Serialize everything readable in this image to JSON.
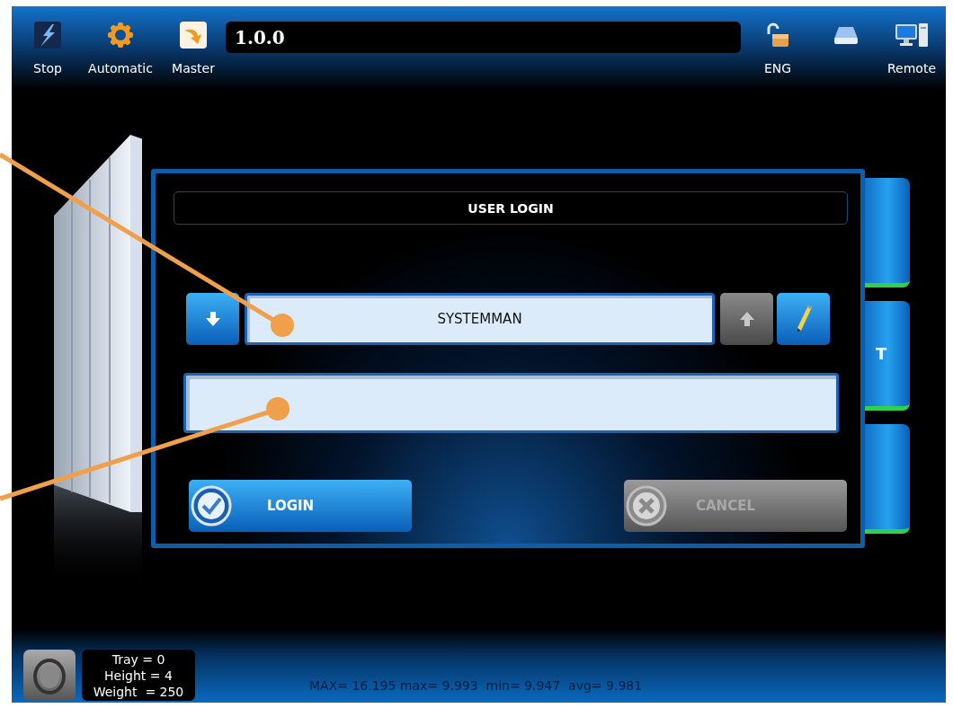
{
  "toolbar": {
    "items": [
      {
        "kind": "stop",
        "label": "Stop"
      },
      {
        "kind": "automatic",
        "label": "Automatic"
      },
      {
        "kind": "master",
        "label": "Master"
      },
      {
        "kind": "version",
        "label": "1.0.0"
      },
      {
        "kind": "lock",
        "label": "ENG"
      },
      {
        "kind": "drive"
      },
      {
        "kind": "remote",
        "label": "Remote"
      }
    ]
  },
  "side_buttons": [
    {
      "kind": "blank"
    },
    {
      "kind": "text",
      "label": "T"
    },
    {
      "kind": "blank"
    }
  ],
  "dialog": {
    "title": "USER LOGIN",
    "user_row": [
      {
        "kind": "down",
        "disabled": false
      },
      {
        "kind": "user",
        "value": "SYSTEMMAN"
      },
      {
        "kind": "up",
        "disabled": true
      },
      {
        "kind": "edit",
        "disabled": false
      }
    ],
    "buttons": [
      {
        "kind": "login",
        "label": "LOGIN",
        "disabled": false
      },
      {
        "kind": "cancel",
        "label": "CANCEL",
        "disabled": true
      }
    ]
  },
  "status_bar": {
    "info": [
      "Tray = 0",
      "Height = 4",
      "Weight  = 250"
    ],
    "stats": "MAX= 16.195 max= 9.993  min= 9.947  avg= 9.981"
  }
}
